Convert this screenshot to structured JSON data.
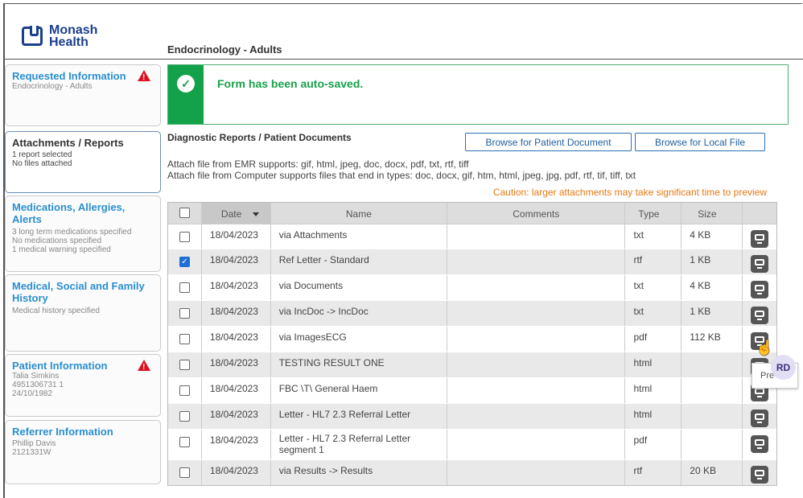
{
  "brand": {
    "line1": "Monash",
    "line2": "Health"
  },
  "page_title": "Endocrinology - Adults",
  "sidebar": [
    {
      "title": "Requested Information",
      "warning": true,
      "lines": [
        "Endocrinology - Adults"
      ]
    },
    {
      "title": "Attachments / Reports",
      "warning": false,
      "active": true,
      "lines": [
        "1 report selected",
        "No files attached"
      ]
    },
    {
      "title": "Medications, Allergies, Alerts",
      "warning": false,
      "lines": [
        "3 long term medications specified",
        "No medications specified",
        "1 medical warning specified"
      ]
    },
    {
      "title": "Medical, Social and Family History",
      "warning": false,
      "lines": [
        "Medical history specified"
      ]
    },
    {
      "title": "Patient Information",
      "warning": true,
      "lines": [
        "Talia Simkins",
        "4951306731 1",
        "24/10/1982"
      ]
    },
    {
      "title": "Referrer Information",
      "warning": false,
      "lines": [
        "Phillip Davis",
        "2121331W"
      ]
    }
  ],
  "banner": {
    "message": "Form has been auto-saved."
  },
  "section": {
    "title": "Diagnostic Reports / Patient Documents",
    "browse_patient": "Browse for Patient Document",
    "browse_local": "Browse for Local File",
    "info1": "Attach file from EMR supports: gif, html, jpeg, doc, docx, pdf, txt, rtf, tiff",
    "info2": "Attach file from Computer supports files that end in types: doc, docx, gif, htm, html, jpeg, jpg, pdf, rtf, tif, tiff, txt",
    "caution": "Caution: larger attachments may take significant time to preview"
  },
  "table": {
    "headers": {
      "date": "Date",
      "name": "Name",
      "comments": "Comments",
      "type": "Type",
      "size": "Size"
    },
    "rows": [
      {
        "date": "18/04/2023",
        "name": "via Attachments",
        "comments": "",
        "type": "txt",
        "size": "4 KB",
        "checked": false
      },
      {
        "date": "18/04/2023",
        "name": "Ref Letter - Standard",
        "comments": "",
        "type": "rtf",
        "size": "1 KB",
        "checked": true
      },
      {
        "date": "18/04/2023",
        "name": "via Documents",
        "comments": "",
        "type": "txt",
        "size": "4 KB",
        "checked": false
      },
      {
        "date": "18/04/2023",
        "name": "via IncDoc -> IncDoc",
        "comments": "",
        "type": "txt",
        "size": "1 KB",
        "checked": false
      },
      {
        "date": "18/04/2023",
        "name": "via ImagesECG",
        "comments": "",
        "type": "pdf",
        "size": "112 KB",
        "checked": false
      },
      {
        "date": "18/04/2023",
        "name": "TESTING RESULT ONE",
        "comments": "",
        "type": "html",
        "size": "",
        "checked": false
      },
      {
        "date": "18/04/2023",
        "name": "FBC \\T\\ General Haem",
        "comments": "",
        "type": "html",
        "size": "",
        "checked": false
      },
      {
        "date": "18/04/2023",
        "name": "Letter - HL7 2.3 Referral Letter",
        "comments": "",
        "type": "html",
        "size": "",
        "checked": false
      },
      {
        "date": "18/04/2023",
        "name": "Letter - HL7 2.3 Referral Letter segment 1",
        "comments": "",
        "type": "pdf",
        "size": "",
        "checked": false
      },
      {
        "date": "18/04/2023",
        "name": "via Results -> Results",
        "comments": "",
        "type": "rtf",
        "size": "20 KB",
        "checked": false
      }
    ]
  },
  "tooltip": "Pre",
  "avatar": "RD",
  "colors": {
    "accent": "#2a8fd0",
    "success": "#13a24a",
    "warning": "#d11122",
    "caution": "#e67a14"
  }
}
